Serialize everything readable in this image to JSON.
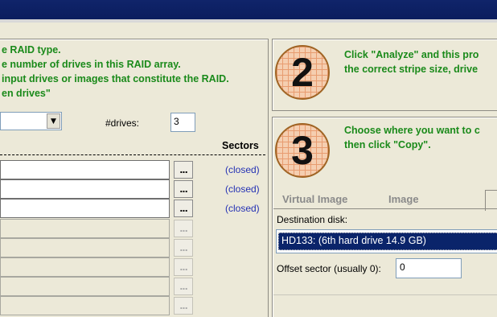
{
  "instructions": {
    "line1": "e RAID type.",
    "line2": "e number of drives in this RAID array.",
    "line3": "input drives or images that constitute the RAID.",
    "line4": "en drives\""
  },
  "raid_type": {
    "value": ""
  },
  "drives": {
    "label": "#drives:",
    "value": "3"
  },
  "sectors_header": "Sectors",
  "drive_rows": [
    {
      "value": "",
      "browse": "...",
      "status": "(closed)",
      "enabled": true
    },
    {
      "value": "",
      "browse": "...",
      "status": "(closed)",
      "enabled": true
    },
    {
      "value": "",
      "browse": "...",
      "status": "(closed)",
      "enabled": true
    },
    {
      "value": "",
      "browse": "...",
      "status": "",
      "enabled": false
    },
    {
      "value": "",
      "browse": "...",
      "status": "",
      "enabled": false
    },
    {
      "value": "",
      "browse": "...",
      "status": "",
      "enabled": false
    },
    {
      "value": "",
      "browse": "...",
      "status": "",
      "enabled": false
    }
  ],
  "step2": {
    "number": "2",
    "line1": "Click \"Analyze\" and this pro",
    "line2": "the correct stripe size, drive"
  },
  "step3": {
    "number": "3",
    "line1": "Choose where you want to c",
    "line2": "then click \"Copy\"."
  },
  "tabs": [
    {
      "label": "Virtual Image",
      "active": false
    },
    {
      "label": "Image",
      "active": false
    },
    {
      "label": "",
      "active": true
    }
  ],
  "destination": {
    "label": "Destination disk:",
    "selected": "HD133: (6th hard drive 14.9 GB)"
  },
  "offset": {
    "label": "Offset sector (usually 0):",
    "value": "0"
  },
  "colors": {
    "title_bar": "#0a1d5e",
    "instruction_text": "#1a8a1a",
    "status_text": "#2431b4",
    "selection": "#0a246a",
    "badge_fill": "#f5ceb0"
  }
}
